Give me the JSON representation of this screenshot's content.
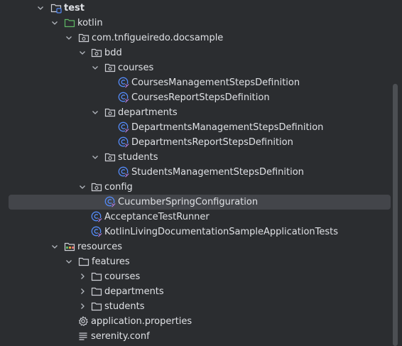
{
  "tree": {
    "test": "test",
    "kotlin": "kotlin",
    "package": "com.tnfigueiredo.docsample",
    "bdd": "bdd",
    "courses": "courses",
    "courses_mgmt": "CoursesManagementStepsDefinition",
    "courses_report": "CoursesReportStepsDefinition",
    "departments": "departments",
    "departments_mgmt": "DepartmentsManagementStepsDefinition",
    "departments_report": "DepartmentsReportStepsDefinition",
    "students": "students",
    "students_mgmt": "StudentsManagementStepsDefinition",
    "config": "config",
    "cucumber_config": "CucumberSpringConfiguration",
    "acceptance_runner": "AcceptanceTestRunner",
    "app_tests": "KotlinLivingDocumentationSampleApplicationTests",
    "resources": "resources",
    "features": "features",
    "features_courses": "courses",
    "features_departments": "departments",
    "features_students": "students",
    "app_properties": "application.properties",
    "serenity_conf": "serenity.conf"
  },
  "colors": {
    "background": "#2b2d30",
    "selection": "#43454a",
    "folder_icon": "#ced0d6",
    "class_icon": "#548af7",
    "resources_icon": "#e8a33e"
  }
}
